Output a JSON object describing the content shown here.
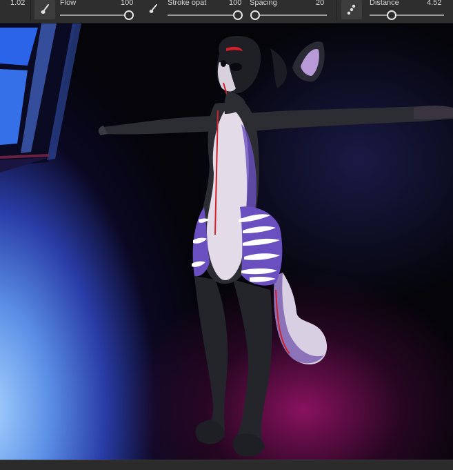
{
  "toolbar": {
    "size_value": "1.02",
    "flow": {
      "label": "Flow",
      "value": "100",
      "level": 1.0
    },
    "stroke_opacity": {
      "label": "Stroke opat",
      "value": "100",
      "level": 1.0
    },
    "spacing": {
      "label": "Spacing",
      "value": "20",
      "level": 0.05
    },
    "distance": {
      "label": "Distance",
      "value": "4.52",
      "level": 0.3
    },
    "icons": [
      "brush-icon",
      "brush-small-icon",
      "scatter-icon"
    ]
  },
  "viewport": {
    "content": "3D character model in T-pose",
    "colors": {
      "fur_dark": "#2b2d33",
      "fur_light": "#e8e0ea",
      "stripe_purple": "#6a4fc0",
      "accent_red": "#d0202a",
      "light_blue": "#7fb8ff",
      "light_magenta": "#a0146e"
    }
  }
}
